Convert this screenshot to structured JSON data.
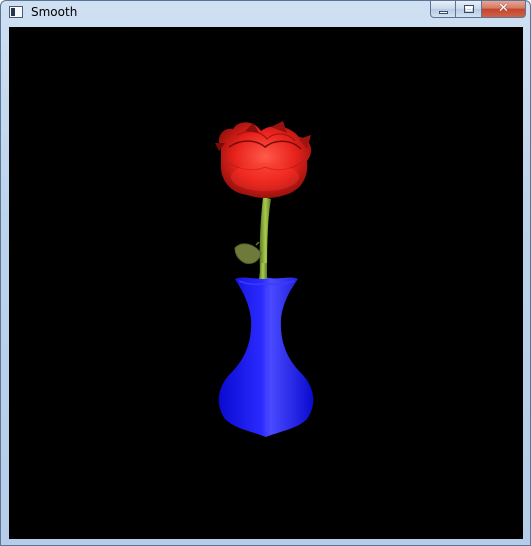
{
  "window": {
    "title": "Smooth",
    "icon": "app-window-icon"
  },
  "caption_buttons": {
    "minimize": "minimize-icon",
    "maximize": "restore-icon",
    "close": "close-icon",
    "close_glyph": "✕"
  },
  "scene": {
    "background_color": "#000000",
    "rose_color": "#e8221c",
    "stem_color": "#8fb33a",
    "leaf_color": "#6e7a3a",
    "vase_color": "#1414f0"
  }
}
